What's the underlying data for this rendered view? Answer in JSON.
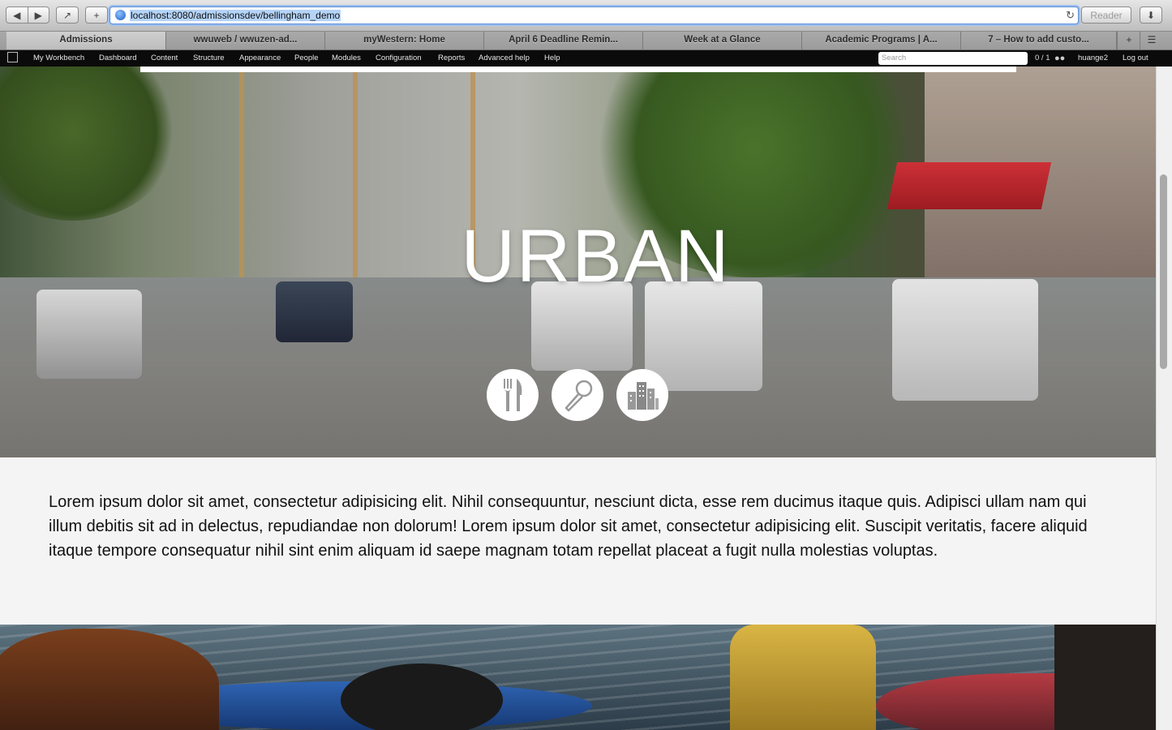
{
  "browser": {
    "url": "localhost:8080/admissionsdev/bellingham_demo",
    "reader_label": "Reader",
    "tabs": [
      {
        "label": "Admissions",
        "active": true
      },
      {
        "label": "wwuweb / wwuzen-ad...",
        "active": false
      },
      {
        "label": "myWestern: Home",
        "active": false
      },
      {
        "label": "April 6 Deadline Remin...",
        "active": false
      },
      {
        "label": "Week at a Glance",
        "active": false
      },
      {
        "label": "Academic Programs | A...",
        "active": false
      },
      {
        "label": "7 – How to add custo...",
        "active": false
      }
    ]
  },
  "admin_menu": {
    "items": [
      "My Workbench",
      "Dashboard",
      "Content",
      "Structure",
      "Appearance",
      "People",
      "Modules",
      "Configuration",
      "Reports",
      "Advanced help",
      "Help"
    ],
    "search_placeholder": "Search",
    "user_count": "0 / 1",
    "username": "huange2",
    "logout": "Log out"
  },
  "hero": {
    "title": "URBAN",
    "icons": [
      "fork-knife-icon",
      "microphone-icon",
      "buildings-icon"
    ]
  },
  "body_text": "Lorem ipsum dolor sit amet, consectetur adipisicing elit. Nihil consequuntur, nesciunt dicta, esse rem ducimus itaque quis. Adipisci ullam nam qui illum debitis sit ad in delectus, repudiandae non dolorum! Lorem ipsum dolor sit amet, consectetur adipisicing elit. Suscipit veritatis, facere aliquid itaque tempore consequatur nihil sint enim aliquam id saepe magnam totam repellat placeat a fugit nulla molestias voluptas."
}
